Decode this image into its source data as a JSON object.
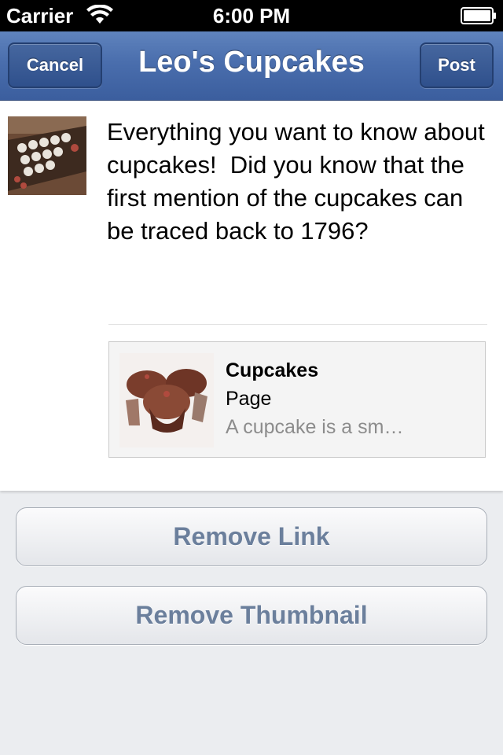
{
  "status_bar": {
    "carrier": "Carrier",
    "time": "6:00 PM",
    "icons": [
      "wifi-icon",
      "battery-icon"
    ]
  },
  "navbar": {
    "title": "Leo's Cupcakes",
    "cancel_label": "Cancel",
    "post_label": "Post"
  },
  "compose": {
    "message": "Everything you want to know about cupcakes!  Did you know that the first mention of the cupcakes can be traced back to 1796?",
    "link_preview": {
      "title": "Cupcakes",
      "type": "Page",
      "description": "A cupcake is a sm…"
    }
  },
  "actions": {
    "remove_link_label": "Remove Link",
    "remove_thumbnail_label": "Remove Thumbnail"
  },
  "colors": {
    "navbar": "#4a6ead",
    "action_text": "#6b7f9c",
    "background": "#ebedf0"
  }
}
